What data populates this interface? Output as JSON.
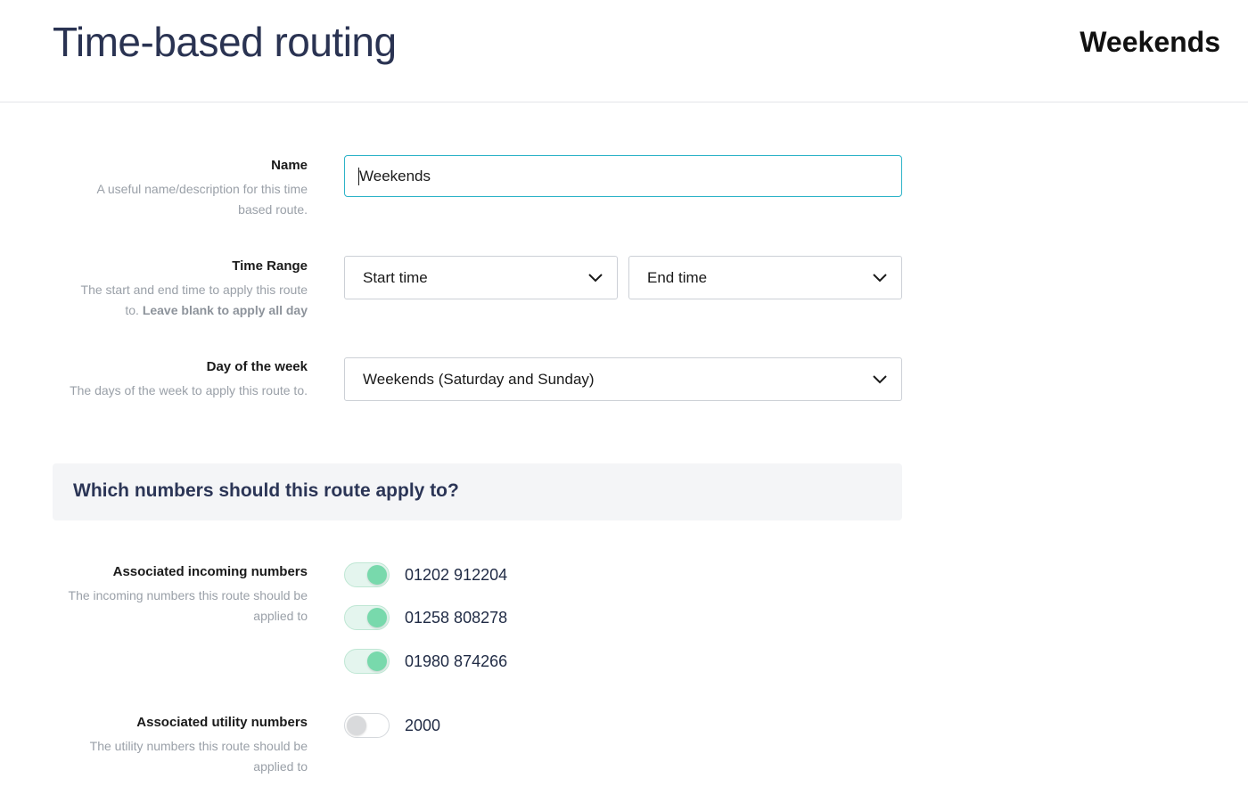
{
  "header": {
    "title": "Time-based routing",
    "route_name": "Weekends"
  },
  "form": {
    "name": {
      "label": "Name",
      "description": "A useful name/description for this time based route.",
      "value": "Weekends"
    },
    "time_range": {
      "label": "Time Range",
      "description_prefix": "The start and end time to apply this route to.",
      "description_bold": "Leave blank to apply all day",
      "start_value": "Start time",
      "end_value": "End time"
    },
    "day_of_week": {
      "label": "Day of the week",
      "description": "The days of the week to apply this route to.",
      "value": "Weekends (Saturday and Sunday)"
    }
  },
  "section": {
    "title": "Which numbers should this route apply to?"
  },
  "incoming": {
    "label": "Associated incoming numbers",
    "description": "The incoming numbers this route should be applied to",
    "numbers": [
      {
        "number": "01202 912204",
        "enabled": true
      },
      {
        "number": "01258 808278",
        "enabled": true
      },
      {
        "number": "01980 874266",
        "enabled": true
      }
    ]
  },
  "utility": {
    "label": "Associated utility numbers",
    "description": "The utility numbers this route should be applied to",
    "numbers": [
      {
        "number": "2000",
        "enabled": false
      }
    ]
  },
  "colors": {
    "accent_input_border": "#2db3c8",
    "toggle_on": "#78d9ac",
    "toggle_off": "#d9dadc",
    "heading": "#2b3556"
  }
}
